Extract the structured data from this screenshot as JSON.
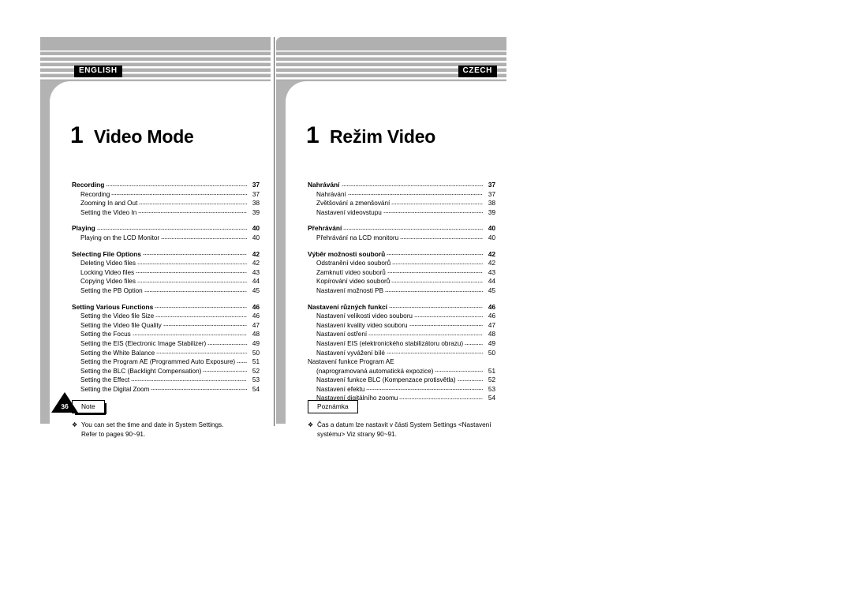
{
  "document": {
    "type": "manual-table-of-contents",
    "chapter_number": "1"
  },
  "colors": {
    "panel_gray": "#b3b3b3",
    "stripe_gray": "#b0b0b0",
    "tag_background": "#000000",
    "tag_text": "#ffffff",
    "page_white": "#ffffff",
    "divider": "#4d4d4d"
  },
  "left_page": {
    "language_tag": "ENGLISH",
    "chapter_number": "1",
    "chapter_title": "Video Mode",
    "page_number": "36",
    "toc_groups": [
      {
        "entries": [
          {
            "label": "Recording",
            "page": "37",
            "level": "head"
          },
          {
            "label": "Recording",
            "page": "37",
            "level": "sub"
          },
          {
            "label": "Zooming In and Out",
            "page": "38",
            "level": "sub"
          },
          {
            "label": "Setting the Video In",
            "page": "39",
            "level": "sub"
          }
        ]
      },
      {
        "entries": [
          {
            "label": "Playing",
            "page": "40",
            "level": "head"
          },
          {
            "label": "Playing on the LCD Monitor",
            "page": "40",
            "level": "sub"
          }
        ]
      },
      {
        "entries": [
          {
            "label": "Selecting File Options",
            "page": "42",
            "level": "head"
          },
          {
            "label": "Deleting Video files",
            "page": "42",
            "level": "sub"
          },
          {
            "label": "Locking Video files",
            "page": "43",
            "level": "sub"
          },
          {
            "label": "Copying Video files",
            "page": "44",
            "level": "sub"
          },
          {
            "label": "Setting the PB Option",
            "page": "45",
            "level": "sub"
          }
        ]
      },
      {
        "entries": [
          {
            "label": "Setting Various Functions",
            "page": "46",
            "level": "head"
          },
          {
            "label": "Setting the Video file Size",
            "page": "46",
            "level": "sub"
          },
          {
            "label": "Setting the Video file Quality",
            "page": "47",
            "level": "sub"
          },
          {
            "label": "Setting the Focus",
            "page": "48",
            "level": "sub"
          },
          {
            "label": "Setting the EIS (Electronic Image Stabilizer)",
            "page": "49",
            "level": "sub"
          },
          {
            "label": "Setting the White Balance",
            "page": "50",
            "level": "sub"
          },
          {
            "label": "Setting the Program AE (Programmed Auto Exposure)",
            "page": "51",
            "level": "sub"
          },
          {
            "label": "Setting the BLC (Backlight Compensation)",
            "page": "52",
            "level": "sub"
          },
          {
            "label": "Setting the Effect",
            "page": "53",
            "level": "sub"
          },
          {
            "label": "Setting the Digital Zoom",
            "page": "54",
            "level": "sub"
          }
        ]
      }
    ],
    "note": {
      "box_label": "Note",
      "bullet": "❖",
      "lines": [
        "You can set the time and date in System Settings.",
        "Refer to pages 90~91."
      ]
    }
  },
  "right_page": {
    "language_tag": "CZECH",
    "chapter_number": "1",
    "chapter_title": "Režim Video",
    "toc_groups": [
      {
        "entries": [
          {
            "label": "Nahrávání",
            "page": "37",
            "level": "head"
          },
          {
            "label": "Nahrávání",
            "page": "37",
            "level": "sub"
          },
          {
            "label": "Zvětšování a zmenšování",
            "page": "38",
            "level": "sub"
          },
          {
            "label": "Nastavení videovstupu",
            "page": "39",
            "level": "sub"
          }
        ]
      },
      {
        "entries": [
          {
            "label": "Přehrávání",
            "page": "40",
            "level": "head"
          },
          {
            "label": "Přehrávání na LCD monitoru",
            "page": "40",
            "level": "sub"
          }
        ]
      },
      {
        "entries": [
          {
            "label": "Výběr možnosti souborů",
            "page": "42",
            "level": "head"
          },
          {
            "label": "Odstranění video souborů",
            "page": "42",
            "level": "sub"
          },
          {
            "label": "Zamknutí video souborů",
            "page": "43",
            "level": "sub"
          },
          {
            "label": "Kopírování video souborů",
            "page": "44",
            "level": "sub"
          },
          {
            "label": "Nastavení možnosti PB",
            "page": "45",
            "level": "sub"
          }
        ]
      },
      {
        "entries": [
          {
            "label": "Nastavení různých funkcí",
            "page": "46",
            "level": "head"
          },
          {
            "label": "Nastavení velikosti video souboru",
            "page": "46",
            "level": "sub"
          },
          {
            "label": "Nastavení kvality video souboru",
            "page": "47",
            "level": "sub"
          },
          {
            "label": "Nastavení ostření",
            "page": "48",
            "level": "sub"
          },
          {
            "label": "Nastavení EIS (elektronického stabilizátoru obrazu)",
            "page": "49",
            "level": "sub"
          },
          {
            "label": "Nastavení vyvážení bílé",
            "page": "50",
            "level": "sub"
          },
          {
            "label": "Nastavení funkce Program AE",
            "page": "",
            "level": "nodots"
          },
          {
            "label": "(naprogramovaná automatická expozice)",
            "page": "51",
            "level": "cont"
          },
          {
            "label": "Nastavení funkce BLC (Kompenzace protisvětla)",
            "page": "52",
            "level": "sub"
          },
          {
            "label": "Nastavení efektu",
            "page": "53",
            "level": "sub"
          },
          {
            "label": "Nastavení digitálního zoomu",
            "page": "54",
            "level": "sub"
          }
        ]
      }
    ],
    "note": {
      "box_label": "Poznámka",
      "bullet": "❖",
      "lines": [
        "Čas a datum lze nastavit v části System Settings <Nastavení",
        "systému> Viz strany 90~91."
      ]
    }
  }
}
